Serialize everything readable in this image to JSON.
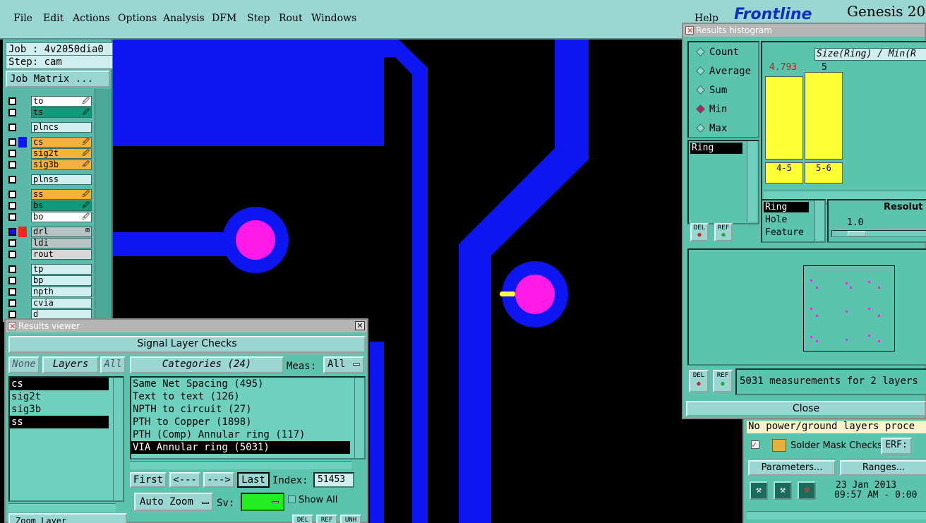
{
  "menubar": {
    "items": [
      "File",
      "Edit",
      "Actions",
      "Options",
      "Analysis",
      "DFM",
      "Step",
      "Rout",
      "Windows"
    ],
    "help": "Help"
  },
  "brand": {
    "logo": "Frontline",
    "product": "Genesis 20"
  },
  "job": {
    "job_label": "Job : 4v2050dia0",
    "step_label": "Step: cam",
    "matrix_button": "Job Matrix ..."
  },
  "layers": [
    {
      "name": "to",
      "color": "#ffffff",
      "mark": "🖉"
    },
    {
      "name": "ts",
      "color": "#0f9a7a",
      "mark": "🖉"
    },
    {
      "name": "plncs",
      "color": "#cfeeed",
      "mark": ""
    },
    {
      "name": "cs",
      "color": "#f5b23a",
      "mark": "🖉"
    },
    {
      "name": "sig2t",
      "color": "#f5b23a",
      "mark": "🖉"
    },
    {
      "name": "sig3b",
      "color": "#f5b23a",
      "mark": "🖉"
    },
    {
      "name": "plnss",
      "color": "#cfeeed",
      "mark": ""
    },
    {
      "name": "ss",
      "color": "#f5b23a",
      "mark": "🖉"
    },
    {
      "name": "bs",
      "color": "#0f9a7a",
      "mark": "🖉"
    },
    {
      "name": "bo",
      "color": "#ffffff",
      "mark": "🖉"
    },
    {
      "name": "drl",
      "color": "#b8c4c4",
      "mark": "⊞"
    },
    {
      "name": "ldi",
      "color": "#b8c4c4",
      "mark": ""
    },
    {
      "name": "rout",
      "color": "#d8d8d8",
      "mark": ""
    },
    {
      "name": "tp",
      "color": "#cfeeed",
      "mark": ""
    },
    {
      "name": "bp",
      "color": "#cfeeed",
      "mark": ""
    },
    {
      "name": "npth",
      "color": "#cfeeed",
      "mark": ""
    },
    {
      "name": "cvia",
      "color": "#cfeeed",
      "mark": ""
    },
    {
      "name": "d",
      "color": "#cfeeed",
      "mark": ""
    }
  ],
  "results_viewer": {
    "title": "Results viewer",
    "header": "Signal Layer Checks",
    "none_btn": "None",
    "layers_btn": "Layers",
    "all_btn": "All",
    "categories_btn": "Categories (24)",
    "meas_label": "Meas:",
    "meas_value": "All",
    "layer_list": [
      {
        "name": "cs",
        "selected": true
      },
      {
        "name": "sig2t",
        "selected": false
      },
      {
        "name": "sig3b",
        "selected": false
      },
      {
        "name": "ss",
        "selected": true
      }
    ],
    "categories": [
      {
        "name": "Same Net Spacing (495)",
        "selected": false
      },
      {
        "name": "Text to text (126)",
        "selected": false
      },
      {
        "name": "NPTH to circuit (27)",
        "selected": false
      },
      {
        "name": "PTH to Copper (1898)",
        "selected": false
      },
      {
        "name": "PTH (Comp) Annular ring (117)",
        "selected": false
      },
      {
        "name": "VIA Annular ring (5031)",
        "selected": true
      }
    ],
    "first_btn": "First",
    "prev_btn": "<---",
    "next_btn": "--->",
    "last_btn": "Last",
    "index_label": "Index:",
    "index_value": "51453",
    "zoom_btn": "Auto Zoom",
    "sv_label": "Sv:",
    "show_all_label": "Show All",
    "bottom_left": "Zoom Layer",
    "bottom_btns": [
      "DEL",
      "REF",
      "UNH"
    ]
  },
  "histogram": {
    "title": "Results histogram",
    "modes": [
      {
        "label": "Count",
        "on": false
      },
      {
        "label": "Average",
        "on": false
      },
      {
        "label": "Sum",
        "on": false
      },
      {
        "label": "Min",
        "on": true
      },
      {
        "label": "Max",
        "on": false
      }
    ],
    "measure_field": "Ring",
    "chart_title": "Size(Ring) / Min(R",
    "bars": [
      {
        "value_label": "4.793",
        "range": "4-5"
      },
      {
        "value_label": "5",
        "range": "5-6"
      }
    ],
    "type_list": [
      {
        "name": "Ring",
        "selected": true
      },
      {
        "name": "Hole",
        "selected": false
      },
      {
        "name": "Feature",
        "selected": false
      }
    ],
    "resolution_label": "Resolut",
    "resolution_value": "1.0",
    "del_btn": "DEL",
    "ref_btn": "REF",
    "status": "5031 measurements for 2 layers",
    "close_btn": "Close"
  },
  "right_panel": {
    "warning": "No power/ground layers proce",
    "check_title": "Solder Mask Checks",
    "erf_btn": "ERF:",
    "parameters_btn": "Parameters...",
    "ranges_btn": "Ranges...",
    "date": "23 Jan 2013",
    "time": "09:57 AM - 0:00"
  },
  "colors": {
    "panel": "#5cc3ac",
    "light": "#9ad6d2",
    "copper": "#0d15f0",
    "pad": "#ff1ae8",
    "bar": "#ffff33"
  }
}
